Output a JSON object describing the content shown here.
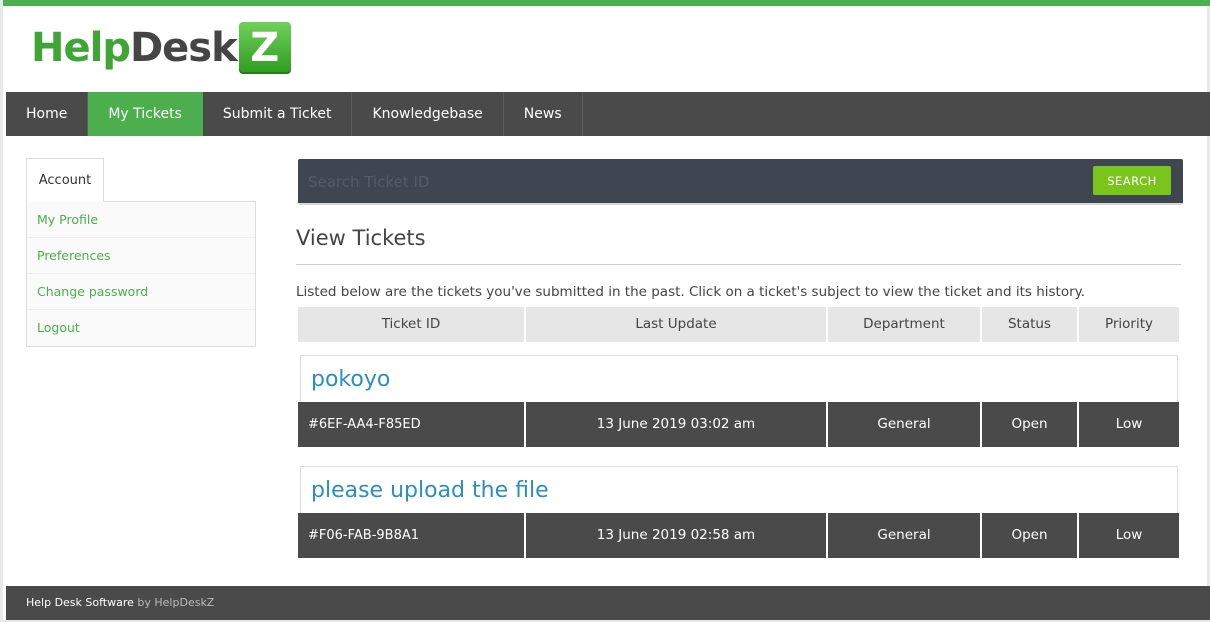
{
  "brand": {
    "logo_part1": "Help",
    "logo_part2": "Desk",
    "logo_box": "Z"
  },
  "nav": {
    "items": [
      {
        "label": "Home",
        "active": false
      },
      {
        "label": "My Tickets",
        "active": true
      },
      {
        "label": "Submit a Ticket",
        "active": false
      },
      {
        "label": "Knowledgebase",
        "active": false
      },
      {
        "label": "News",
        "active": false
      }
    ]
  },
  "sidebar": {
    "tab": "Account",
    "items": [
      {
        "label": "My Profile"
      },
      {
        "label": "Preferences"
      },
      {
        "label": "Change password"
      },
      {
        "label": "Logout"
      }
    ]
  },
  "search": {
    "placeholder": "Search Ticket ID",
    "button_label": "SEARCH"
  },
  "main": {
    "title": "View Tickets",
    "intro": "Listed below are the tickets you've submitted in the past. Click on a ticket's subject to view the ticket and its history.",
    "columns": [
      "Ticket ID",
      "Last Update",
      "Department",
      "Status",
      "Priority"
    ],
    "tickets": [
      {
        "subject": "pokoyo",
        "id": "#6EF-AA4-F85ED",
        "last_update": "13 June 2019 03:02 am",
        "department": "General",
        "status": "Open",
        "priority": "Low"
      },
      {
        "subject": "please upload the file",
        "id": "#F06-FAB-9B8A1",
        "last_update": "13 June 2019 02:58 am",
        "department": "General",
        "status": "Open",
        "priority": "Low"
      }
    ]
  },
  "footer": {
    "text": "Help Desk Software",
    "by": "by HelpDeskZ"
  },
  "colors": {
    "accent": "#4cae4c",
    "nav_bg": "#4a4a4a",
    "link": "#2a8fc4",
    "search_button": "#7ac51c"
  }
}
